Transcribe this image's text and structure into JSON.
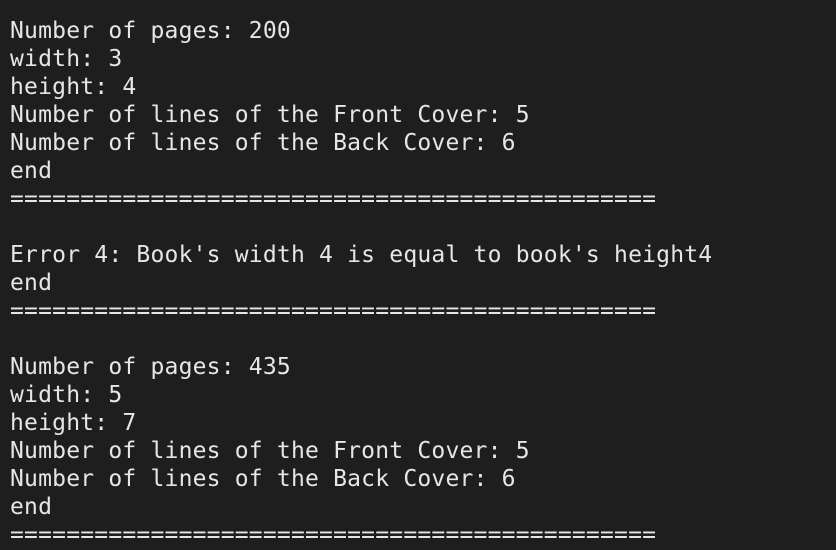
{
  "terminal": {
    "lines": [
      "Number of pages: 200",
      "width: 3",
      "height: 4",
      "Number of lines of the Front Cover: 5",
      "Number of lines of the Back Cover: 6",
      "end",
      "==============================================",
      "",
      "Error 4: Book's width 4 is equal to book's height4",
      "end",
      "==============================================",
      "",
      "Number of pages: 435",
      "width: 5",
      "height: 7",
      "Number of lines of the Front Cover: 5",
      "Number of lines of the Back Cover: 6",
      "end",
      "=============================================="
    ]
  }
}
